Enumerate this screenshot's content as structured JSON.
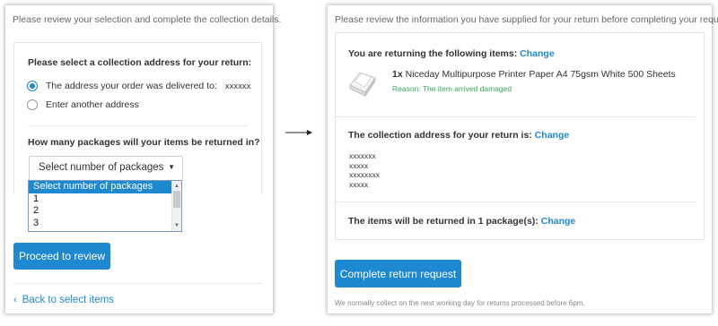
{
  "left": {
    "intro": "Please review your selection and complete the collection details.",
    "address_heading": "Please select a collection address for your return:",
    "address_options": [
      {
        "label": "The address your order was delivered to:",
        "value": "xxxxxx",
        "selected": true
      },
      {
        "label": "Enter another address",
        "selected": false
      }
    ],
    "packages_heading": "How many packages will your items be returned in?",
    "packages_select": {
      "value": "Select number of packages",
      "options": [
        "Select number of packages",
        "1",
        "2",
        "3"
      ]
    },
    "proceed_button": "Proceed to review",
    "back_link": "Back to select items"
  },
  "right": {
    "intro": "Please review the information you have supplied for your return before completing your request.",
    "items_heading": "You are returning the following items:",
    "items_change": "Change",
    "item": {
      "quantity": "1x",
      "name": "Niceday Multipurpose Printer Paper A4 75gsm White 500 Sheets",
      "reason": "Reason: The item arrived damaged"
    },
    "address_heading": "The collection address for your return is:",
    "address_change": "Change",
    "address_lines": [
      "xxxxxxx",
      "xxxxx",
      "xxxxxxxx",
      "xxxxx"
    ],
    "packages_heading": "The items will be returned in 1 package(s):",
    "packages_change": "Change",
    "complete_button": "Complete return request",
    "footnote": "We normally collect on the next working day for returns processed before 6pm."
  },
  "colors": {
    "accent": "#1e88d0",
    "reason_green": "#3aa35b",
    "text": "#333333",
    "muted": "#666666"
  },
  "icons": {
    "flow_arrow": "arrow-right-icon",
    "back": "chevron-left-icon",
    "product": "printer-paper-icon"
  }
}
